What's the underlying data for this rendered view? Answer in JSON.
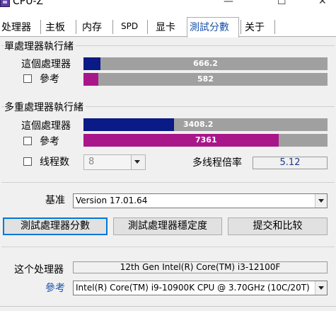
{
  "window": {
    "title": "CPU-Z",
    "minimize_glyph": "—",
    "maximize_glyph": "☐",
    "close_glyph": "✕"
  },
  "tabs": [
    "处理器",
    "主板",
    "内存",
    "SPD",
    "显卡",
    "測試分數",
    "关于"
  ],
  "active_tab": "測試分數",
  "single_thread": {
    "group_title": "單處理器執行緒",
    "this_label": "這個處理器",
    "ref_label": "參考",
    "this_value": "666.2",
    "ref_value": "582",
    "this_fraction": 0.07,
    "ref_fraction": 0.06
  },
  "multi_thread": {
    "group_title": "多重處理器執行緒",
    "this_label": "這個處理器",
    "ref_label": "參考",
    "this_value": "3408.2",
    "ref_value": "7361",
    "this_fraction": 0.37,
    "ref_fraction": 0.8,
    "threads_label": "线程数",
    "threads_value": "8",
    "ratio_label": "多线程倍率",
    "ratio_value": "5.12"
  },
  "benchmark": {
    "label": "基准",
    "version": "Version 17.01.64"
  },
  "buttons": {
    "bench": "測試處理器分數",
    "stress": "測試處理器穩定度",
    "submit": "提交和比较"
  },
  "info": {
    "this_label": "这个处理器",
    "this_cpu": "12th Gen Intel(R) Core(TM) i3-12100F",
    "ref_label": "參考",
    "ref_cpu": "Intel(R) Core(TM) i9-10900K CPU @ 3.70GHz (10C/20T)"
  },
  "colors": {
    "this_bar": "#0a1a86",
    "ref_bar": "#a8168a",
    "bar_track": "#a0a0a0",
    "ratio_text": "#1a3a8c",
    "ref_label": "#1a52a8"
  }
}
